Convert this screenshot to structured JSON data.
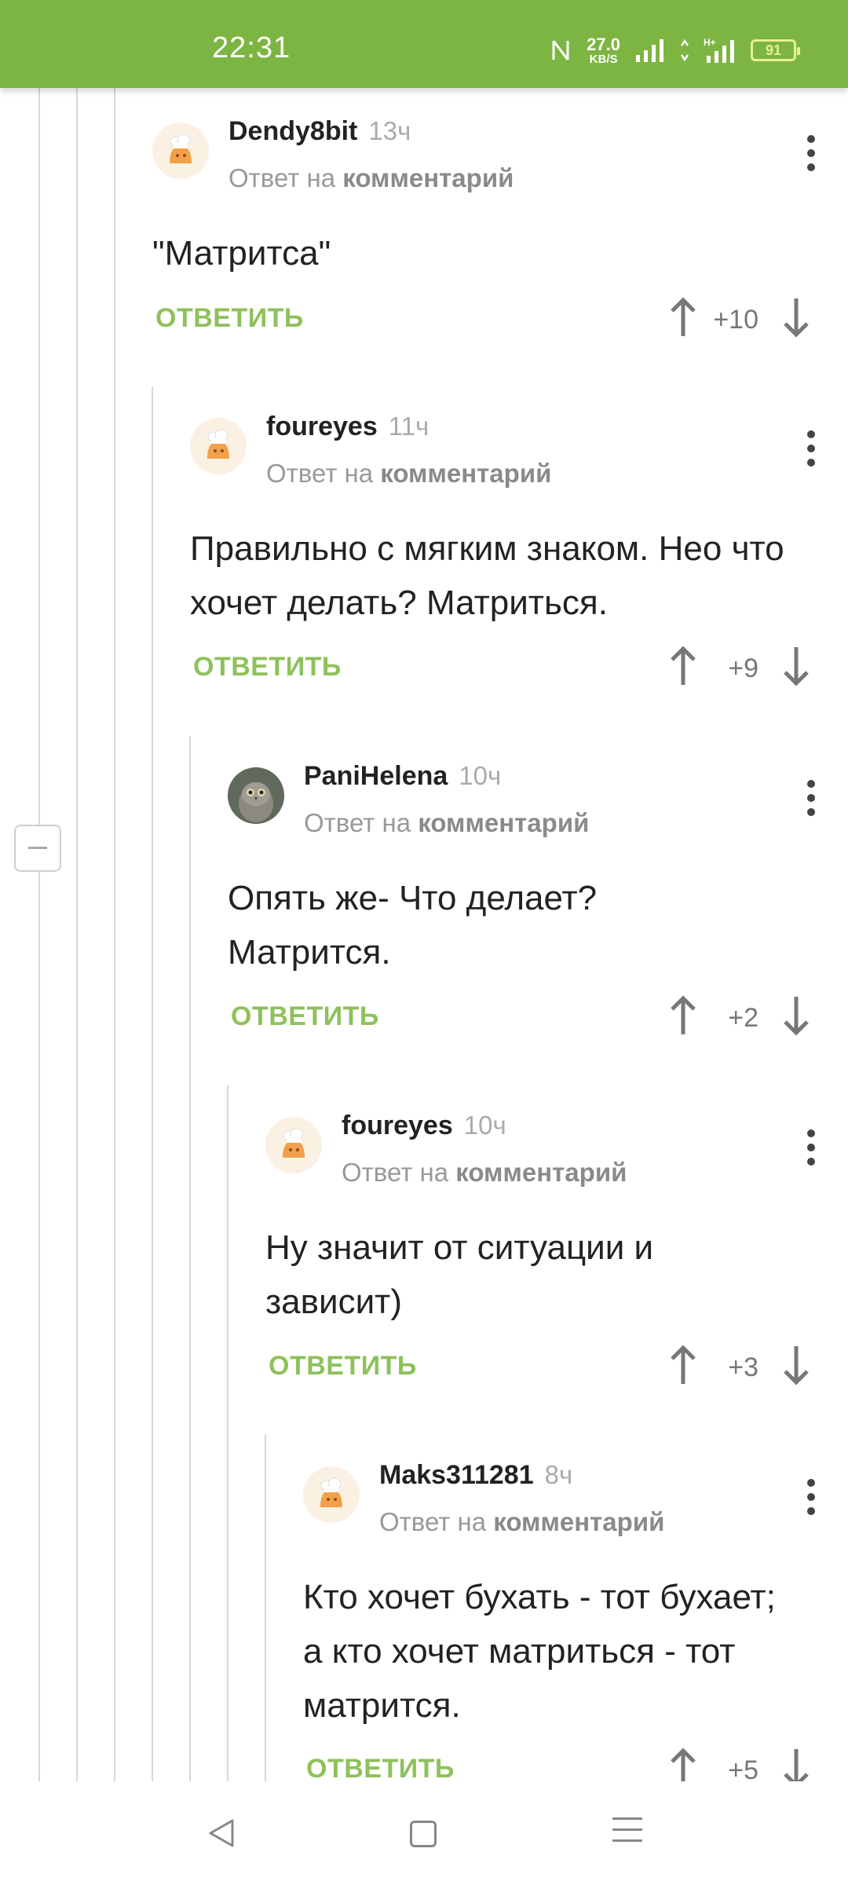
{
  "status": {
    "time": "22:31",
    "net_speed_value": "27.0",
    "net_speed_unit": "KB/S",
    "network_type": "H+",
    "battery": "91"
  },
  "reply_prefix": "Ответ на",
  "reply_target": "комментарий",
  "reply_label": "ОТВЕТИТЬ",
  "comments": [
    {
      "author": "Dendy8bit",
      "time": "13ч",
      "text": "\"Матритса\"",
      "score": "+10",
      "avatar": "chef-avatar-icon"
    },
    {
      "author": "foureyes",
      "time": "11ч",
      "text": "Правильно с мягким знаком. Нео что хочет делать? Матриться.",
      "score": "+9",
      "avatar": "chef-avatar-icon"
    },
    {
      "author": "PaniHelena",
      "time": "10ч",
      "text": "Опять же- Что делает? Матрится.",
      "score": "+2",
      "avatar": "owl-avatar-icon"
    },
    {
      "author": "foureyes",
      "time": "10ч",
      "text": "Ну значит от ситуации и зависит)",
      "score": "+3",
      "avatar": "chef-avatar-icon"
    },
    {
      "author": "Maks311281",
      "time": "8ч",
      "text": "Кто хочет бухать - тот бухает; а кто хочет матриться - тот матрится.",
      "score": "+5",
      "avatar": "chef-avatar-icon"
    }
  ],
  "colors": {
    "status_bar": "#7db543",
    "reply_button": "#8ec15b",
    "thread_line": "#d8d8d8"
  }
}
